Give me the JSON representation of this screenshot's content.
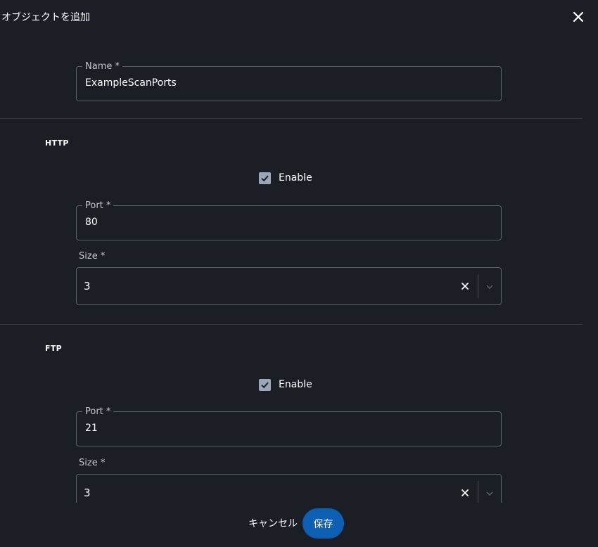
{
  "dialog": {
    "title": "オブジェクトを追加"
  },
  "name_field": {
    "label": "Name *",
    "value": "ExampleScanPorts"
  },
  "sections": [
    {
      "title": "HTTP",
      "enable_label": "Enable",
      "enabled": true,
      "port_label": "Port *",
      "port_value": "80",
      "size_label": "Size *",
      "size_value": "3"
    },
    {
      "title": "FTP",
      "enable_label": "Enable",
      "enabled": true,
      "port_label": "Port *",
      "port_value": "21",
      "size_label": "Size *",
      "size_value": "3"
    }
  ],
  "footer": {
    "cancel_label": "キャンセル",
    "save_label": "保存"
  },
  "icons": {
    "close": "close-icon",
    "check": "checkmark-icon",
    "clear": "clear-icon",
    "chevron": "chevron-down-icon"
  },
  "colors": {
    "background": "#1b1e24",
    "primary": "#0d5fb3",
    "checkbox": "#9aa7b8",
    "border": "#5b616b"
  }
}
